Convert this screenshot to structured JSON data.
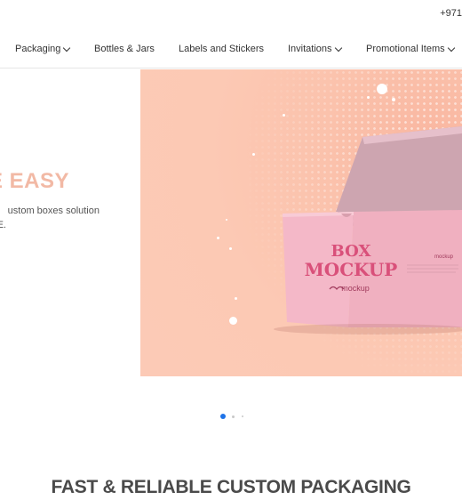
{
  "topbar": {
    "phone": "+971"
  },
  "nav": {
    "items": [
      {
        "label": "Packaging",
        "has_dropdown": true
      },
      {
        "label": "Bottles & Jars",
        "has_dropdown": false
      },
      {
        "label": "Labels and Stickers",
        "has_dropdown": false
      },
      {
        "label": "Invitations",
        "has_dropdown": true
      },
      {
        "label": "Promotional Items",
        "has_dropdown": true
      }
    ]
  },
  "hero": {
    "headline": "E EASY",
    "tagline_line1": "ustom boxes solution",
    "tagline_line2": "E.",
    "slide": {
      "box_title_line1": "BOX",
      "box_title_line2": "MOCKUP",
      "box_brand": "mockup",
      "box_side_brand": "mockup",
      "background_color": "#fcc6b2",
      "box_color": "#f4b8c8",
      "box_text_color": "#d9507a"
    },
    "slider_dots": {
      "count": 3,
      "active": 1,
      "active_color": "#1e73e8",
      "inactive_color": "#c8c8c8"
    }
  },
  "section": {
    "title": "FAST & RELIABLE CUSTOM PACKAGING"
  }
}
